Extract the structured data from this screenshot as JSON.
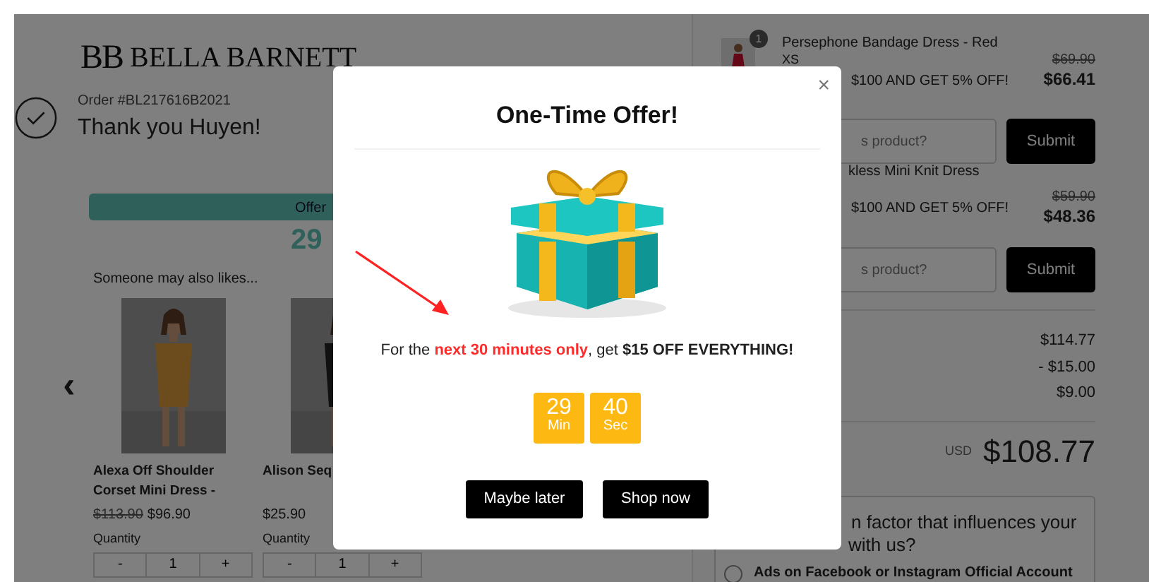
{
  "header": {
    "logo_mark": "BB",
    "brand": "BELLA BARNETT",
    "order_number": "Order #BL217616B2021",
    "thank_you": "Thank you Huyen!"
  },
  "offer_bar": {
    "label": "Offer",
    "minutes": "29"
  },
  "recommendations": {
    "title": "Someone may also likes...",
    "prev": "‹",
    "products": [
      {
        "name": "Alexa Off Shoulder Corset Mini Dress -",
        "old_price": "$113.90",
        "price": "$96.90",
        "quantity_label": "Quantity",
        "decrement": "-",
        "quantity": "1",
        "increment": "+",
        "kind": "full"
      },
      {
        "name": "Alison Seq",
        "price": "$25.90",
        "quantity_label": "Quantity",
        "decrement": "-",
        "quantity": "1",
        "increment": "+",
        "kind": "cut"
      }
    ]
  },
  "cart": {
    "items": [
      {
        "badge": "1",
        "name": "Persephone Bandage Dress - Red",
        "variant": "XS",
        "promo": "$100 AND GET 5% OFF!",
        "old_price": "$69.90",
        "price": "$66.41",
        "field_placeholder": "s product?",
        "submit": "Submit"
      },
      {
        "name": "kless Mini Knit Dress",
        "promo": "$100 AND GET 5% OFF!",
        "old_price": "$59.90",
        "price": "$48.36",
        "field_placeholder": "s product?",
        "submit": "Submit"
      }
    ],
    "totals": [
      "$114.77",
      "- $15.00",
      "$9.00"
    ],
    "currency": "USD",
    "grand_total": "$108.77",
    "survey": {
      "question_lines": [
        "n factor that influences your",
        "with us?"
      ],
      "options": [
        {
          "label": "Ads on Facebook or Instagram Official Account",
          "selected": false
        }
      ]
    }
  },
  "modal": {
    "close": "×",
    "title": "One-Time Offer!",
    "message": [
      {
        "text": "For the ",
        "kind": "plain"
      },
      {
        "text": "next 30 minutes only",
        "kind": "highlight"
      },
      {
        "text": ", get ",
        "kind": "plain"
      },
      {
        "text": "$15 OFF EVERYTHING!",
        "kind": "strong"
      }
    ],
    "countdown": [
      {
        "value": "29",
        "unit": "Min"
      },
      {
        "value": "40",
        "unit": "Sec"
      }
    ],
    "buttons": [
      "Maybe later",
      "Shop now"
    ]
  }
}
